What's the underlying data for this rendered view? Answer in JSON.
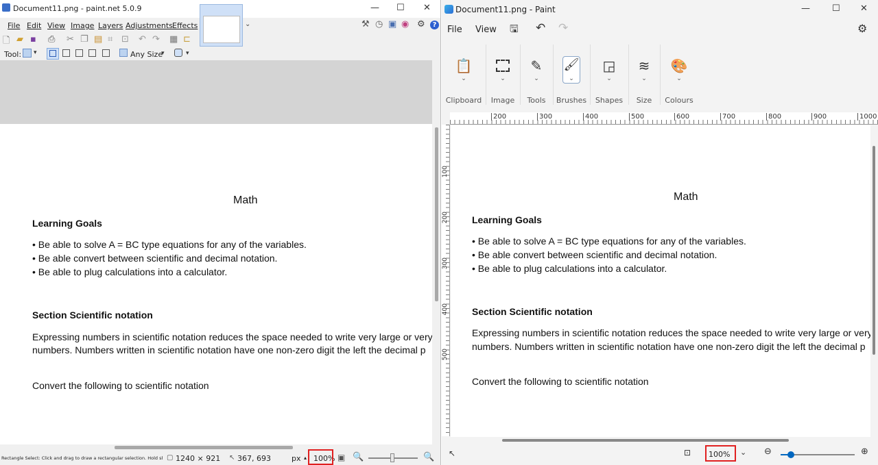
{
  "pdn": {
    "title": "Document11.png - paint.net 5.0.9",
    "menu": [
      "File",
      "Edit",
      "View",
      "Image",
      "Layers",
      "Adjustments",
      "Effects"
    ],
    "tool_label": "Tool:",
    "any_size": "Any Size",
    "status_hint": "Rectangle Select: Click and drag to draw a rectangular selection. Hold shift to constr...",
    "image_size": "1240 × 921",
    "cursor_pos": "367, 693",
    "units": "px",
    "zoom": "100%"
  },
  "document": {
    "heading": "Math",
    "learning_goals": "Learning Goals",
    "bullets": [
      "• Be able to solve A = BC type equations for any of the variables.",
      "• Be able convert between scientific and decimal notation.",
      "• Be able to plug calculations into a calculator."
    ],
    "section": "Section Scientific notation",
    "para_line1": "Expressing numbers in scientific notation reduces the space needed to write very large or very",
    "para_line2": "numbers. Numbers written in scientific notation have one non-zero digit the left the decimal p",
    "convert": "Convert the following to scientific notation"
  },
  "mspaint": {
    "title": "Document11.png - Paint",
    "menu_file": "File",
    "menu_view": "View",
    "ribbon": [
      "Clipboard",
      "Image",
      "Tools",
      "Brushes",
      "Shapes",
      "Size",
      "Colours"
    ],
    "ruler_h": [
      "200",
      "300",
      "400",
      "500",
      "600",
      "700",
      "800",
      "900",
      "1000"
    ],
    "ruler_v": [
      "100",
      "200",
      "300",
      "400",
      "500"
    ],
    "zoom": "100%"
  },
  "colors": {
    "highlight": "#e02020",
    "accent": "#0067c0"
  }
}
